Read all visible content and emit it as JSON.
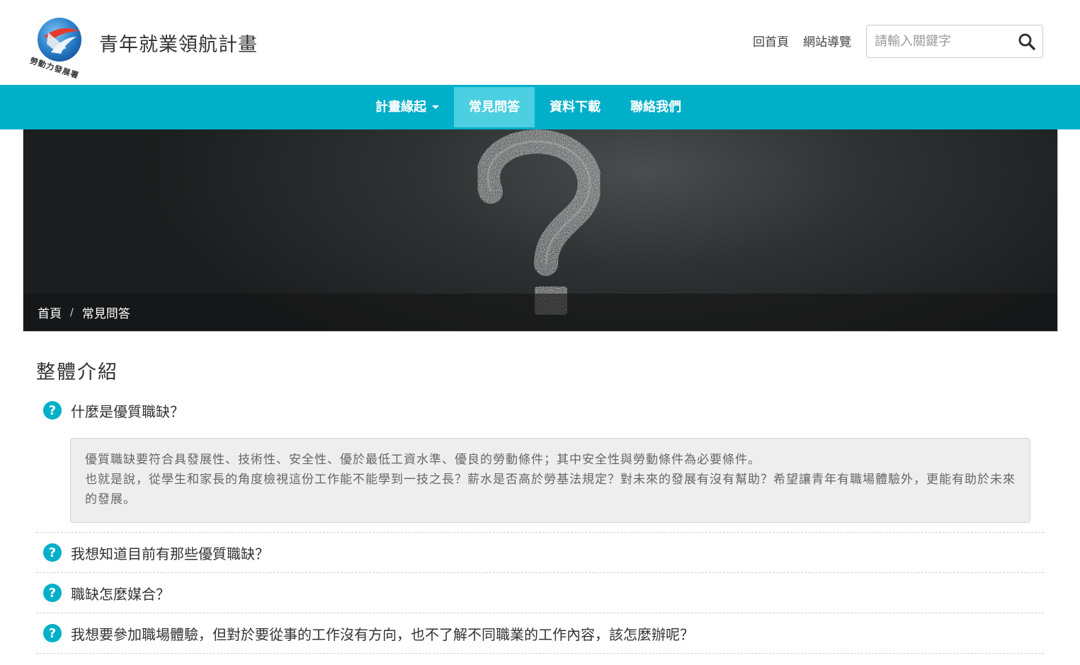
{
  "header": {
    "logo_text": "勞動力發展署",
    "site_title": "青年就業領航計畫",
    "links": {
      "home": "回首頁",
      "sitemap": "網站導覽"
    },
    "search": {
      "placeholder": "請輸入關鍵字",
      "icon": "search-icon"
    }
  },
  "nav": {
    "items": [
      {
        "label": "計畫緣起",
        "has_dropdown": true,
        "active": false
      },
      {
        "label": "常見問答",
        "has_dropdown": false,
        "active": true
      },
      {
        "label": "資料下載",
        "has_dropdown": false,
        "active": false
      },
      {
        "label": "聯絡我們",
        "has_dropdown": false,
        "active": false
      }
    ]
  },
  "banner": {
    "breadcrumb": {
      "home": "首頁",
      "separator": "/",
      "current": "常見問答"
    }
  },
  "main": {
    "section_title": "整體介紹",
    "faq": [
      {
        "question": "什麼是優質職缺？",
        "expanded": true,
        "answer_lines": [
          "優質職缺要符合具發展性、技術性、安全性、優於最低工資水準、優良的勞動條件；其中安全性與勞動條件為必要條件。",
          "也就是說，從學生和家長的角度檢視這份工作能不能學到一技之長？薪水是否高於勞基法規定？對未來的發展有沒有幫助？希望讓青年有職場體驗外，更能有助於未來的發展。"
        ]
      },
      {
        "question": "我想知道目前有那些優質職缺？",
        "expanded": false
      },
      {
        "question": "職缺怎麼媒合？",
        "expanded": false
      },
      {
        "question": "我想要參加職場體驗，但對於要從事的工作沒有方向，也不了解不同職業的工作內容，該怎麼辦呢？",
        "expanded": false
      }
    ]
  },
  "colors": {
    "navbar": "#00afc8",
    "nav_active": "#4ccfe0",
    "question_icon": "#00afc8",
    "answer_bg": "#eeeeee"
  }
}
